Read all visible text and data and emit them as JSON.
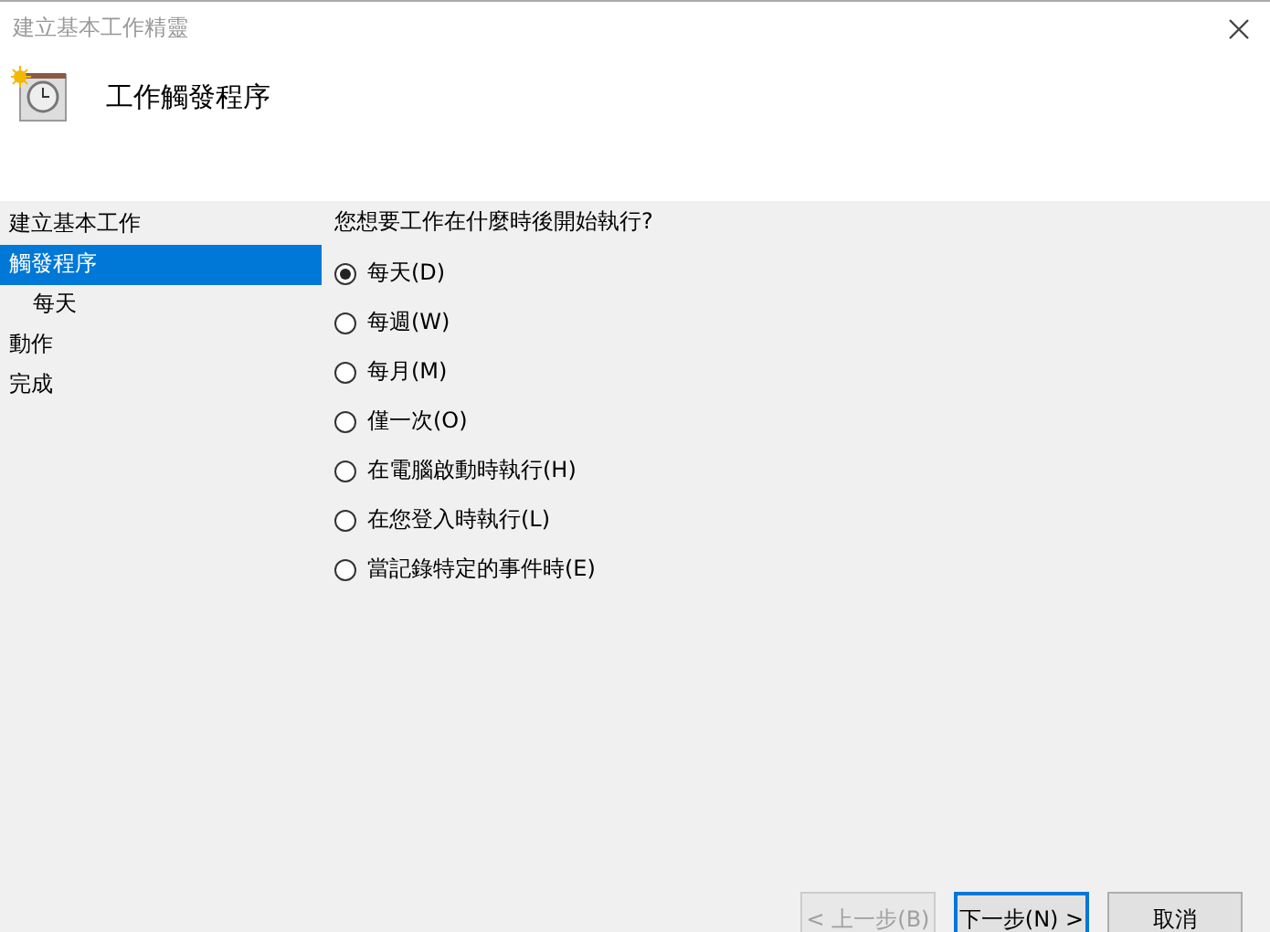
{
  "window": {
    "title": "建立基本工作精靈"
  },
  "header": {
    "title": "工作觸發程序"
  },
  "sidebar": {
    "items": [
      {
        "label": "建立基本工作",
        "selected": false
      },
      {
        "label": "觸發程序",
        "selected": true,
        "children": [
          {
            "label": "每天",
            "selected": false
          }
        ]
      },
      {
        "label": "動作",
        "selected": false
      },
      {
        "label": "完成",
        "selected": false
      }
    ]
  },
  "question": "您想要工作在什麼時後開始執行?",
  "options": [
    {
      "label": "每天(D)",
      "selected": true
    },
    {
      "label": "每週(W)",
      "selected": false
    },
    {
      "label": "每月(M)",
      "selected": false
    },
    {
      "label": "僅一次(O)",
      "selected": false
    },
    {
      "label": "在電腦啟動時執行(H)",
      "selected": false
    },
    {
      "label": "在您登入時執行(L)",
      "selected": false
    },
    {
      "label": "當記錄特定的事件時(E)",
      "selected": false
    }
  ],
  "buttons": [
    {
      "label": "< 上一步(B)",
      "disabled": true,
      "default": false
    },
    {
      "label": "下一步(N) >",
      "disabled": false,
      "default": true
    },
    {
      "label": "取消",
      "disabled": false,
      "default": false
    }
  ]
}
